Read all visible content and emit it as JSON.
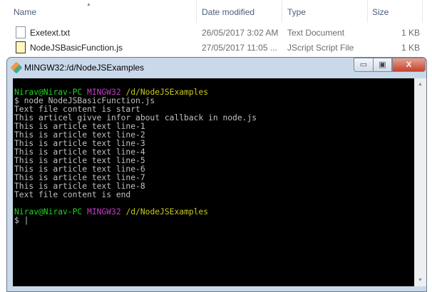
{
  "explorer": {
    "columns": [
      "Name",
      "Date modified",
      "Type",
      "Size"
    ],
    "files": [
      {
        "name": "Exetext.txt",
        "date": "26/05/2017 3:02 AM",
        "type": "Text Document",
        "size": "1 KB",
        "icon": "text-file-icon"
      },
      {
        "name": "NodeJSBasicFunction.js",
        "date": "27/05/2017 11:05 ...",
        "type": "JScript Script File",
        "size": "1 KB",
        "icon": "js-file-icon"
      }
    ]
  },
  "terminal": {
    "title": "MINGW32:/d/NodeJSExamples",
    "buttons": {
      "minimize": "▭",
      "maximize": "▣",
      "close": "X"
    },
    "prompt": {
      "user": "Nirav@Nirav-PC",
      "env": "MINGW32",
      "path": "/d/NodeJSExamples"
    },
    "command": "$ node NodeJSBasicFunction.js",
    "output": [
      "Text file content is start",
      "This articel givve infor about callback in node.js",
      "This is article text line-1",
      "This is article text line-2",
      "This is article text line-3",
      "This is article text line-4",
      "This is article text line-5",
      "This is article text line-6",
      "This is article text line-7",
      "This is article text line-8",
      "Text file content is end"
    ],
    "cursor_line": "$ |"
  }
}
